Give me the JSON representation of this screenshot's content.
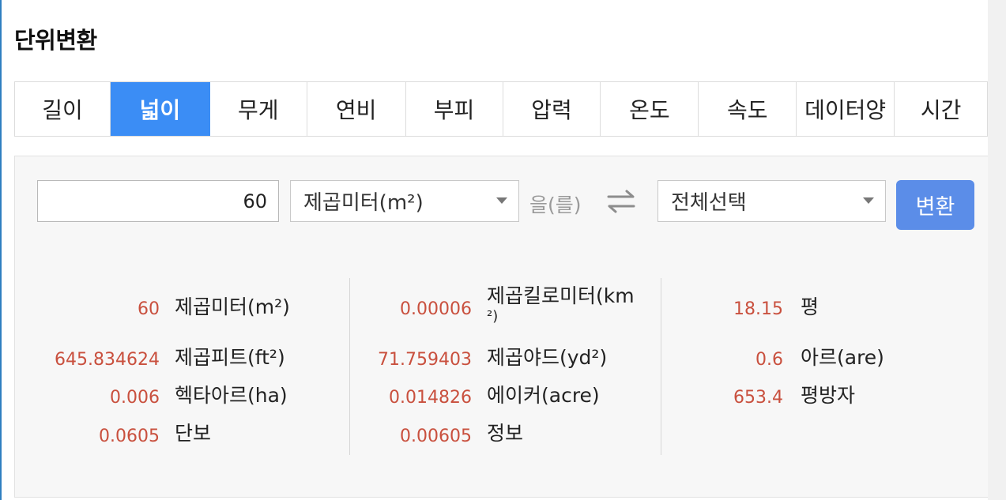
{
  "page_title": "단위변환",
  "tabs": [
    {
      "label": "길이",
      "active": false
    },
    {
      "label": "넓이",
      "active": true
    },
    {
      "label": "무게",
      "active": false
    },
    {
      "label": "연비",
      "active": false
    },
    {
      "label": "부피",
      "active": false
    },
    {
      "label": "압력",
      "active": false
    },
    {
      "label": "온도",
      "active": false
    },
    {
      "label": "속도",
      "active": false
    },
    {
      "label": "데이터양",
      "active": false
    },
    {
      "label": "시간",
      "active": false
    }
  ],
  "converter": {
    "input_value": "60",
    "from_unit": "제곱미터(m²)",
    "particle": "을(를)",
    "to_unit": "전체선택",
    "convert_label": "변환"
  },
  "results": {
    "col1": [
      {
        "value": "60",
        "unit": "제곱미터(m²)"
      },
      {
        "value": "645.834624",
        "unit": "제곱피트(ft²)"
      },
      {
        "value": "0.006",
        "unit": "헥타아르(ha)"
      },
      {
        "value": "0.0605",
        "unit": "단보"
      }
    ],
    "col2": [
      {
        "value": "0.00006",
        "unit_line1": "제곱킬로미터(km",
        "unit_line2": "²)"
      },
      {
        "value": "71.759403",
        "unit": "제곱야드(yd²)"
      },
      {
        "value": "0.014826",
        "unit": "에이커(acre)"
      },
      {
        "value": "0.00605",
        "unit": "정보"
      }
    ],
    "col3": [
      {
        "value": "18.15",
        "unit": "평"
      },
      {
        "value": "0.6",
        "unit": "아르(are)"
      },
      {
        "value": "653.4",
        "unit": "평방자"
      }
    ]
  },
  "colors": {
    "accent": "#3b8df5",
    "button": "#5b8de8",
    "result_value": "#c9503e"
  },
  "icons": {
    "swap": "swap-arrows-icon",
    "dropdown": "chevron-down-icon"
  }
}
